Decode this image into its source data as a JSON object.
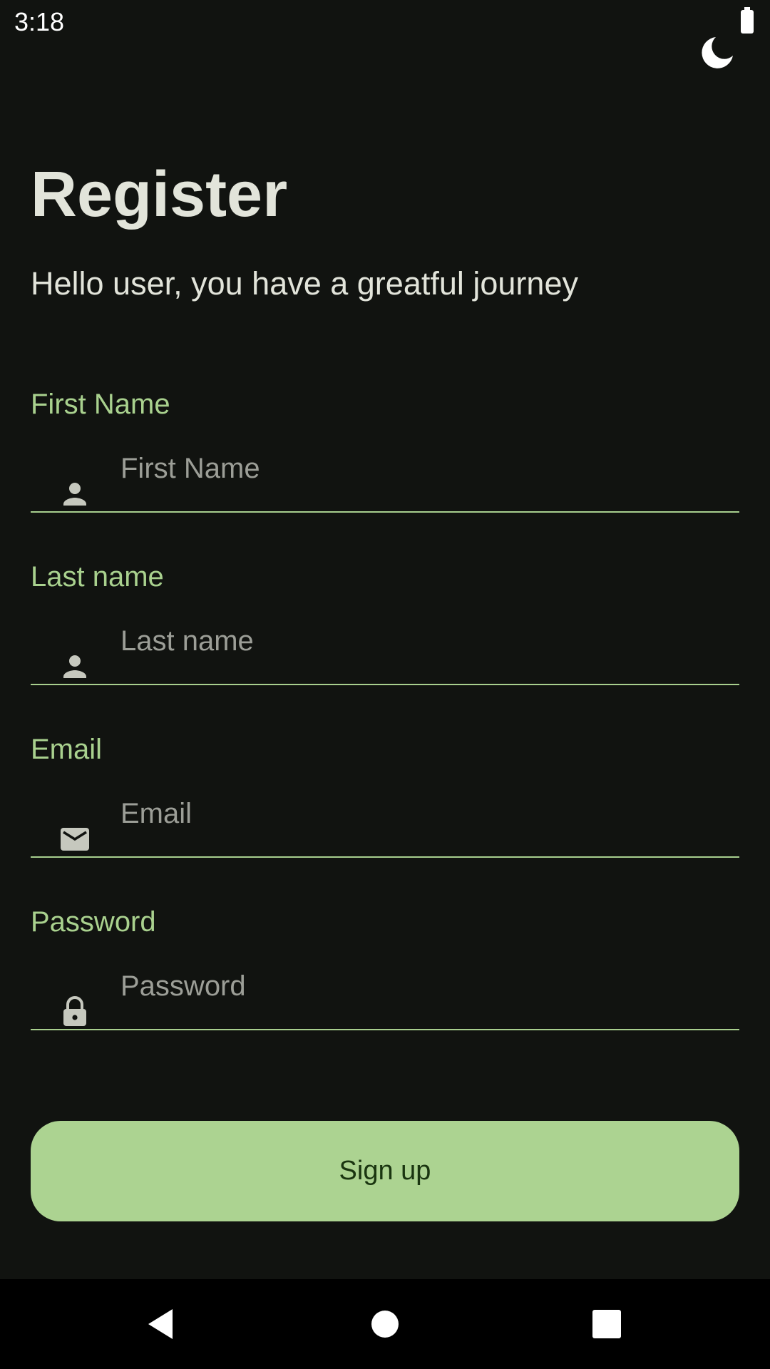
{
  "status_bar": {
    "time": "3:18",
    "battery_icon": "battery-full-icon"
  },
  "theme_toggle": {
    "icon": "moon-icon"
  },
  "header": {
    "title": "Register",
    "subtitle": "Hello user, you have a greatful journey"
  },
  "form": {
    "fields": [
      {
        "label": "First Name",
        "placeholder": "First Name",
        "value": "",
        "icon": "person-icon"
      },
      {
        "label": "Last name",
        "placeholder": "Last name",
        "value": "",
        "icon": "person-icon"
      },
      {
        "label": "Email",
        "placeholder": "Email",
        "value": "",
        "icon": "mail-icon"
      },
      {
        "label": "Password",
        "placeholder": "Password",
        "value": "",
        "icon": "lock-icon"
      }
    ],
    "submit_label": "Sign up"
  },
  "colors": {
    "background": "#111310",
    "accent": "#acd391",
    "label": "#a9d18e",
    "text": "#e2e4da"
  },
  "nav_bar": {
    "back_icon": "back-triangle-icon",
    "home_icon": "home-circle-icon",
    "recents_icon": "recents-square-icon"
  }
}
